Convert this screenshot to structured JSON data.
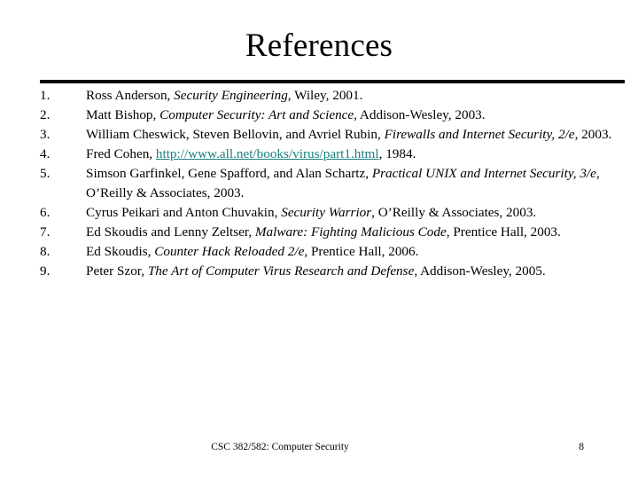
{
  "slide": {
    "title": "References",
    "footer": {
      "course": "CSC 382/582: Computer Security",
      "page_number": "8"
    },
    "colors": {
      "text": "#000000",
      "background": "#ffffff",
      "rule": "#000000",
      "hyperlink": "#1a7f7f"
    }
  },
  "references": [
    {
      "number": "1.",
      "plain": "Ross Anderson, Security Engineering, Wiley, 2001.",
      "authors": "Ross Anderson, ",
      "title_italic": "Security Engineering",
      "tail": ", Wiley, 2001."
    },
    {
      "number": "2.",
      "plain": "Matt Bishop, Computer Security: Art and Science, Addison-Wesley, 2003.",
      "authors": "Matt Bishop, ",
      "title_italic": "Computer Security: Art and Science",
      "tail": ", Addison-Wesley, 2003."
    },
    {
      "number": "3.",
      "plain": "William Cheswick, Steven Bellovin, and Avriel Rubin, Firewalls and Internet Security, 2/e, 2003.",
      "authors": "William Cheswick, Steven Bellovin, and Avriel Rubin, ",
      "title_italic": "Firewalls and Internet Security, 2/e",
      "tail": ", 2003."
    },
    {
      "number": "4.",
      "plain": "Fred Cohen, http://www.all.net/books/virus/part1.html, 1984.",
      "authors": "Fred Cohen, ",
      "link_text": "http://www.all.net/books/virus/part1.html",
      "tail": ", 1984."
    },
    {
      "number": "5.",
      "plain": "Simson Garfinkel, Gene Spafford, and Alan Schartz, Practical UNIX and Internet Security, 3/e, O’Reilly & Associates, 2003.",
      "authors": "Simson Garfinkel, Gene Spafford, and Alan Schartz, ",
      "title_italic": "Practical UNIX and Internet Security, 3/e",
      "tail": ", O’Reilly & Associates, 2003."
    },
    {
      "number": "6.",
      "plain": "Cyrus Peikari and Anton Chuvakin, Security Warrior, O’Reilly & Associates, 2003.",
      "authors": "Cyrus Peikari and Anton Chuvakin, ",
      "title_italic": "Security Warrior",
      "tail": ", O’Reilly & Associates, 2003."
    },
    {
      "number": "7.",
      "plain": "Ed Skoudis and Lenny Zeltser, Malware: Fighting Malicious Code, Prentice Hall, 2003.",
      "authors": "Ed Skoudis and Lenny Zeltser, ",
      "title_italic": "Malware: Fighting Malicious Code",
      "tail": ", Prentice Hall, 2003."
    },
    {
      "number": "8.",
      "plain": "Ed Skoudis, Counter Hack Reloaded 2/e, Prentice Hall, 2006.",
      "authors": "Ed Skoudis, ",
      "title_italic": "Counter Hack Reloaded 2/e",
      "tail": ", Prentice Hall, 2006."
    },
    {
      "number": "9.",
      "plain": "Peter Szor, The Art of Computer Virus Research and Defense, Addison-Wesley, 2005.",
      "authors": "Peter Szor, ",
      "title_italic": "The Art of Computer Virus Research and Defense",
      "tail": ", Addison-Wesley, 2005."
    }
  ]
}
